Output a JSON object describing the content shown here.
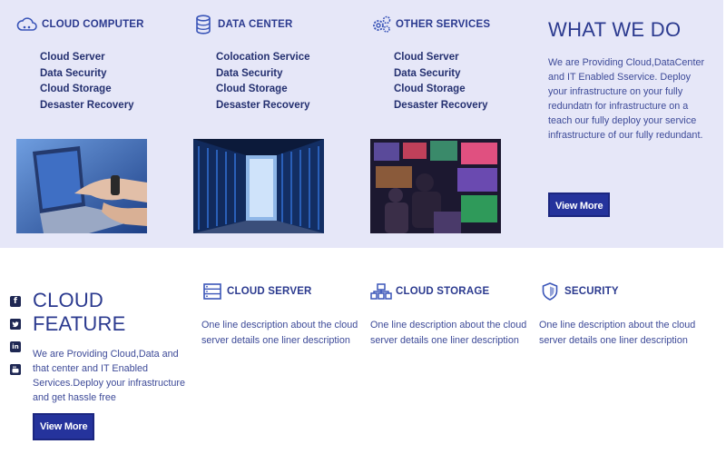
{
  "columns": [
    {
      "icon": "cloud-icon",
      "title": "CLOUD COMPUTER",
      "links": [
        "Cloud Server",
        "Data Security",
        "Cloud Storage",
        "Desaster Recovery"
      ]
    },
    {
      "icon": "database-icon",
      "title": "DATA CENTER",
      "links": [
        "Colocation Service",
        "Data Security",
        "Cloud Storage",
        "Desaster Recovery"
      ]
    },
    {
      "icon": "gears-icon",
      "title": "OTHER SERVICES",
      "links": [
        "Cloud Server",
        "Data Security",
        "Cloud Storage",
        "Desaster Recovery"
      ]
    }
  ],
  "images": [
    "laptop-hands-photo",
    "server-racks-photo",
    "control-room-photo"
  ],
  "what_we_do": {
    "title": "WHAT WE DO",
    "text": "We are Providing Cloud,DataCenter and IT Enabled Sservice. Deploy your infrastructure on your fully redundatn for infrastructure on a teach our fully deploy your service infrastructure of our fully redundant.",
    "button": "View More"
  },
  "social": [
    "facebook-icon",
    "twitter-icon",
    "linkedin-icon",
    "youtube-icon"
  ],
  "cloud_feature": {
    "title": "CLOUD FEATURE",
    "text": "We are Providing Cloud,Data and that center and IT Enabled Services.Deploy your infrastructure and get hassle free",
    "button": "View More"
  },
  "features": [
    {
      "icon": "server-icon",
      "title": "CLOUD SERVER",
      "text": "One line description about the cloud server details one liner description"
    },
    {
      "icon": "network-storage-icon",
      "title": "CLOUD STORAGE",
      "text": "One line description about the cloud server details one liner description"
    },
    {
      "icon": "shield-icon",
      "title": "SECURITY",
      "text": "One line description about the cloud server details one liner description"
    }
  ],
  "colors": {
    "top_bg": "#e6e7f8",
    "accent": "#2b3a8f",
    "button": "#25339c"
  }
}
